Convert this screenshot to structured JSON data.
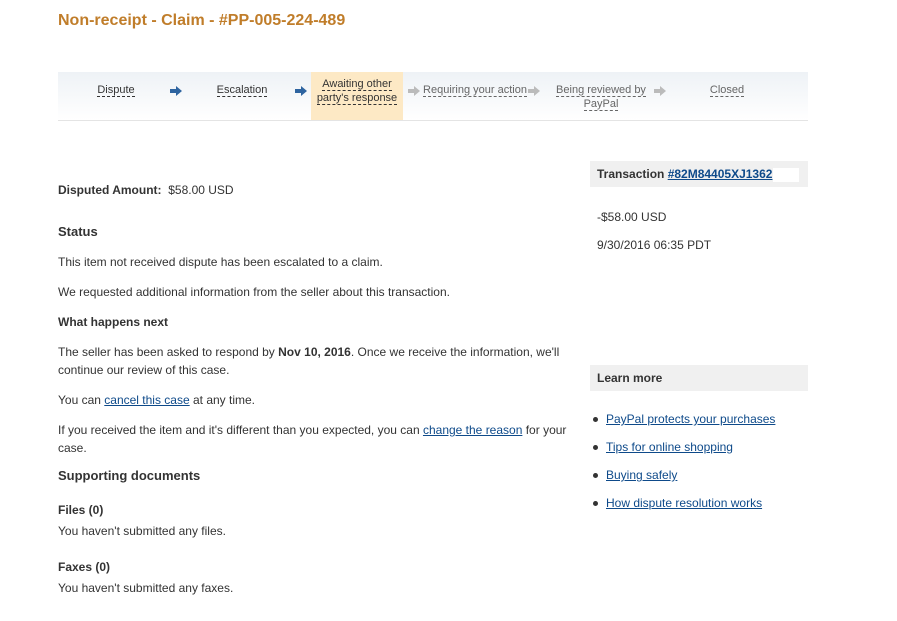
{
  "page": {
    "title": "Non-receipt - Claim - #PP-005-224-489"
  },
  "progress": {
    "steps": [
      {
        "label": "Dispute",
        "state": "done"
      },
      {
        "label": "Escalation",
        "state": "done"
      },
      {
        "label": "Awaiting other party's response",
        "state": "current"
      },
      {
        "label": "Requiring your action",
        "state": "future"
      },
      {
        "label": "Being reviewed by PayPal",
        "state": "future"
      },
      {
        "label": "Closed",
        "state": "future"
      }
    ],
    "colors": {
      "done_arrow": "#2e64a0",
      "future_arrow": "#bbbbbb",
      "current_bg": "#fde9c5"
    }
  },
  "summary": {
    "disputed_amount_label": "Disputed Amount:",
    "disputed_amount_value": "$58.00 USD"
  },
  "status": {
    "heading": "Status",
    "line1": "This item not received dispute has been escalated to a claim.",
    "line2": "We requested additional information from the seller about this transaction.",
    "next_heading": "What happens next",
    "next_pre": "The seller has been asked to respond by ",
    "next_date": "Nov 10, 2016",
    "next_post": ". Once we receive the information, we'll continue our review of this case.",
    "cancel_pre": "You can ",
    "cancel_link": "cancel this case",
    "cancel_post": " at any time.",
    "change_pre": "If you received the item and it's different than you expected, you can ",
    "change_link": "change the reason",
    "change_post": " for your case."
  },
  "documents": {
    "heading": "Supporting documents",
    "files_label": "Files (0)",
    "files_text": "You haven't submitted any files.",
    "faxes_label": "Faxes (0)",
    "faxes_text": "You haven't submitted any faxes."
  },
  "transaction": {
    "label": "Transaction ",
    "id": "#82M84405XJ1362",
    "amount": "-$58.00 USD",
    "datetime": "9/30/2016 06:35 PDT"
  },
  "learn_more": {
    "heading": "Learn more",
    "links": [
      "PayPal protects your purchases",
      "Tips for online shopping",
      "Buying safely",
      "How dispute resolution works"
    ]
  }
}
